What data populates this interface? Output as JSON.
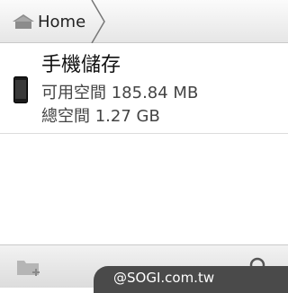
{
  "breadcrumb": {
    "home_label": "Home",
    "home_icon": "home-icon"
  },
  "storage": {
    "icon": "phone-icon",
    "title": "手機儲存",
    "free_space": "可用空間 185.84 MB",
    "total_space": "總空間 1.27 GB"
  },
  "bottom_bar": {
    "new_folder_icon": "new-folder-icon",
    "search_icon": "search-icon"
  },
  "watermark": {
    "text": "@SOGI.com.tw"
  }
}
